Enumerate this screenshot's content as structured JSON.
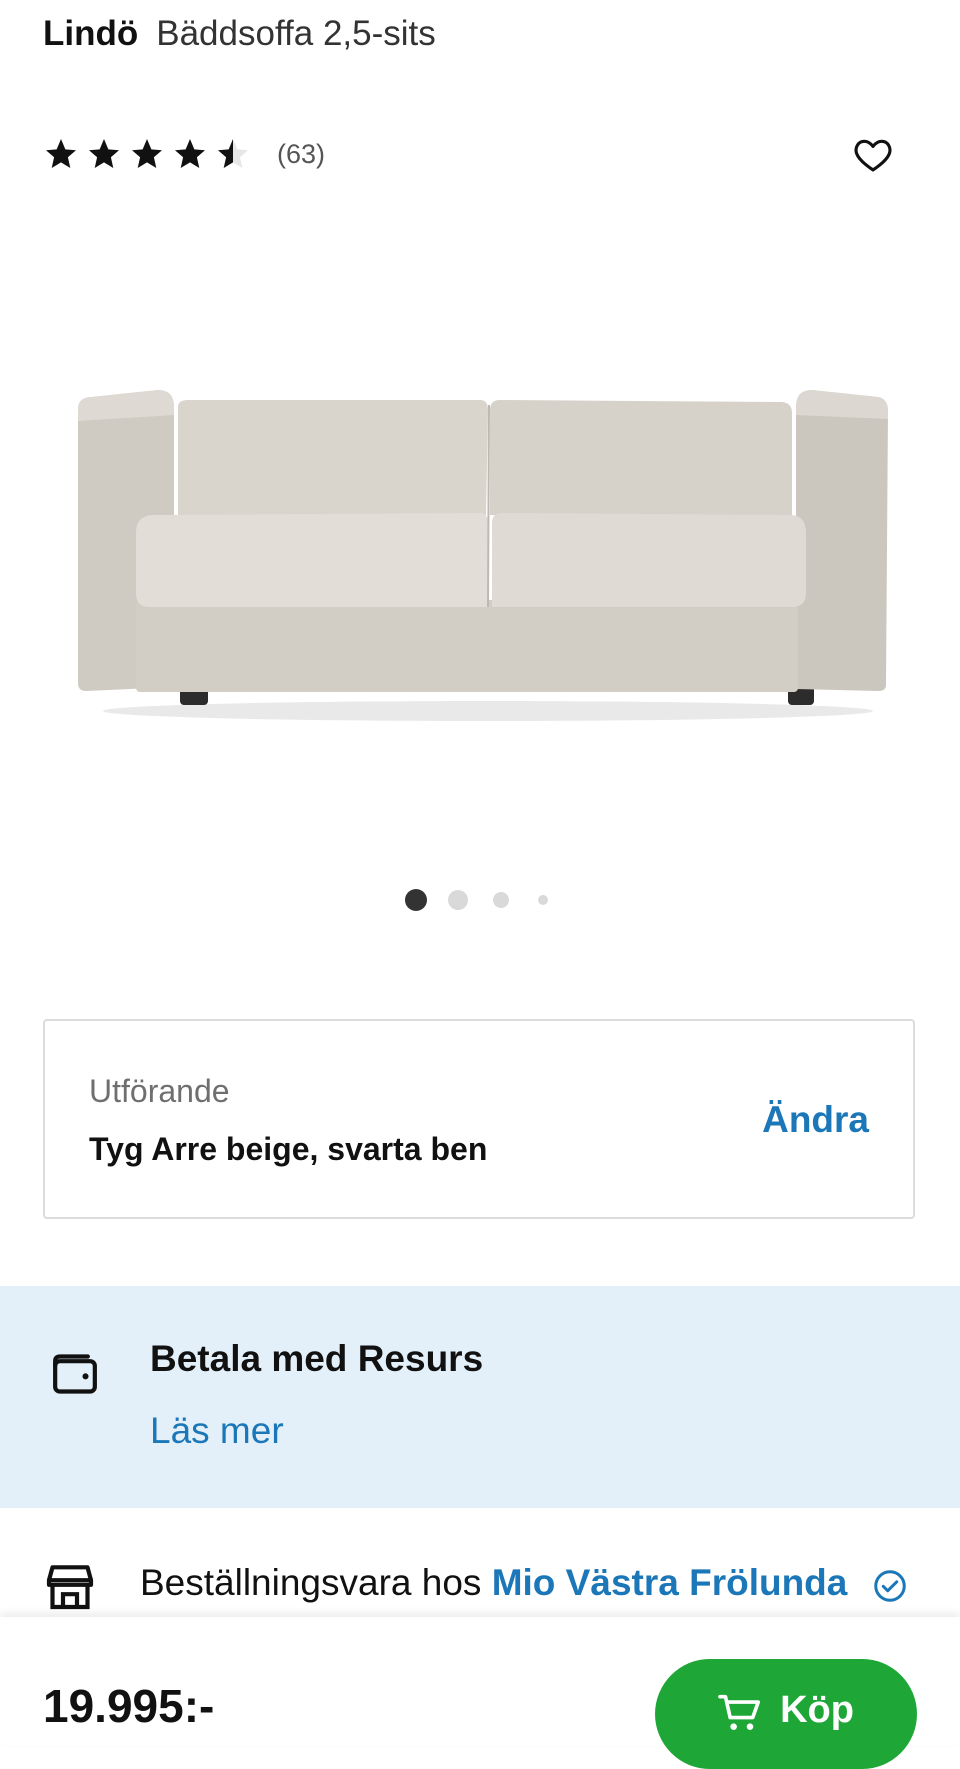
{
  "header": {
    "brand": "Lindö",
    "product_name": "Bäddsoffa 2,5-sits"
  },
  "rating": {
    "value": 4.5,
    "max": 5,
    "count_label": "(63)"
  },
  "icons": {
    "favorite": "heart-outline-icon",
    "payment": "wallet-icon",
    "store": "store-icon",
    "verified": "check-circle-icon",
    "cart": "shopping-cart-icon"
  },
  "gallery": {
    "image_alt": "Bäddsoffa Lindö",
    "total_images": 4,
    "active_index": 0
  },
  "variant": {
    "label": "Utförande",
    "value": "Tyg Arre beige, svarta ben",
    "change_label": "Ändra"
  },
  "payment": {
    "title": "Betala med Resurs",
    "link": "Läs mer"
  },
  "store": {
    "prefix": "Beställningsvara hos ",
    "store_name": "Mio Västra Frölunda"
  },
  "purchase": {
    "price": "19.995:-",
    "buy_label": "Köp"
  },
  "colors": {
    "accent_blue": "#1b77b8",
    "buy_green": "#1ea737",
    "band_blue": "#e4f0f9"
  }
}
